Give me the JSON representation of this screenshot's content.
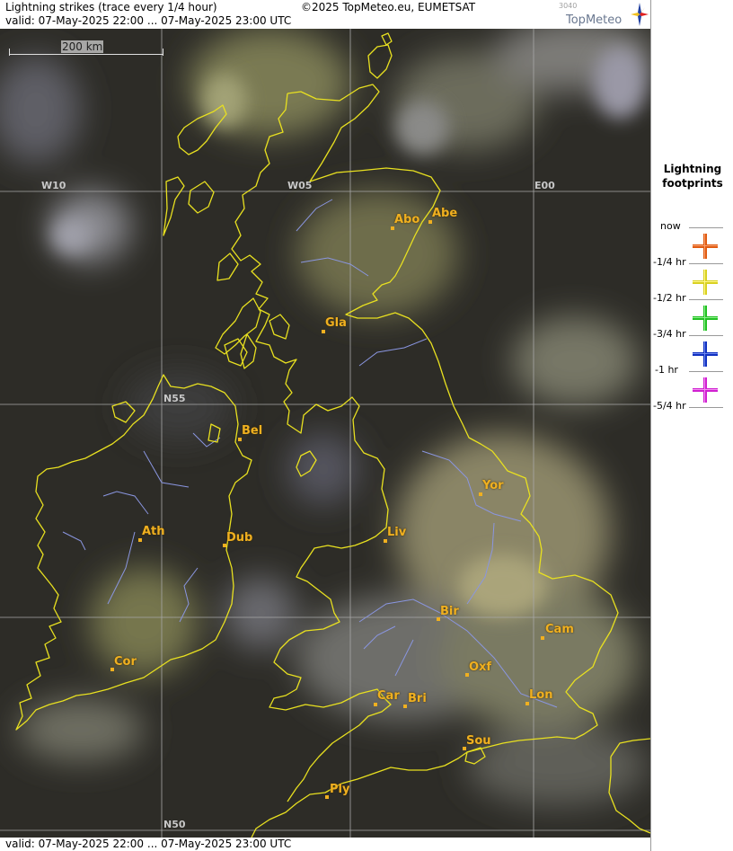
{
  "header": {
    "title": "Lightning strikes (trace every 1/4 hour)",
    "copyright": "©2025 TopMeteo.eu, EUMETSAT",
    "valid": "valid:  07-May-2025 22:00 ... 07-May-2025 23:00 UTC"
  },
  "logo": {
    "code": "3040",
    "name": "TopMeteo"
  },
  "footer": {
    "valid": "valid:  07-May-2025 22:00 ... 07-May-2025 23:00 UTC"
  },
  "scale": {
    "label": "200 km"
  },
  "grid_labels": {
    "w10": "W10",
    "w05": "W05",
    "e00": "E00",
    "n55": "N55",
    "n50": "N50"
  },
  "cities": [
    {
      "name": "Abo"
    },
    {
      "name": "Abe"
    },
    {
      "name": "Gla"
    },
    {
      "name": "Bel"
    },
    {
      "name": "Yor"
    },
    {
      "name": "Ath"
    },
    {
      "name": "Dub"
    },
    {
      "name": "Liv"
    },
    {
      "name": "Bir"
    },
    {
      "name": "Cam"
    },
    {
      "name": "Cor"
    },
    {
      "name": "Oxf"
    },
    {
      "name": "Car"
    },
    {
      "name": "Bri"
    },
    {
      "name": "Lon"
    },
    {
      "name": "Sou"
    },
    {
      "name": "Ply"
    }
  ],
  "legend": {
    "title_line1": "Lightning",
    "title_line2": "footprints",
    "items": [
      {
        "label": "now",
        "color": "#e05a10"
      },
      {
        "label": "-1/4 hr",
        "color": "#e0e020"
      },
      {
        "label": "-1/2 hr",
        "color": "#20c020"
      },
      {
        "label": "-3/4 hr",
        "color": "#1030c0"
      },
      {
        "label": "-1 hr",
        "color": "#d020d0"
      },
      {
        "label": "-5/4 hr",
        "color": ""
      }
    ]
  },
  "colors": {
    "coastline": "#e8e020",
    "rivers": "#8a96e0",
    "grid": "#a0a0a0",
    "city": "#f0b020"
  }
}
